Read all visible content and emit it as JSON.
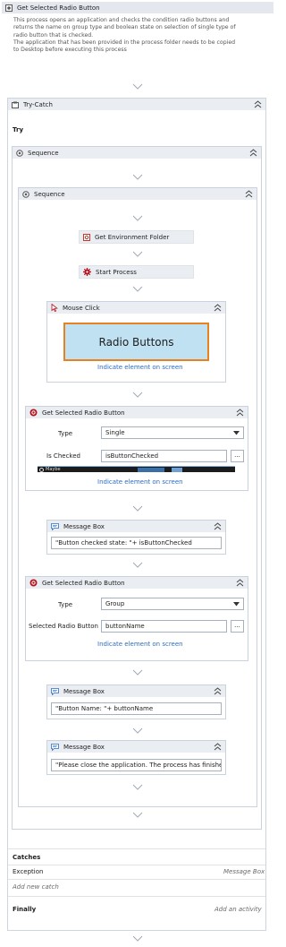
{
  "root": {
    "title": "Get Selected Radio Button",
    "description": [
      "This process opens an application and checks the condition radio buttons and",
      "returns the name on group type and boolean state on selection of single type of",
      "radio button that is checked.",
      "The application that has been provided in the process folder needs to be copied",
      "to Desktop before executing this process"
    ]
  },
  "try_catch": {
    "title": "Try-Catch",
    "try_label": "Try"
  },
  "sequence_outer": {
    "title": "Sequence"
  },
  "sequence_inner": {
    "title": "Sequence"
  },
  "get_env_folder": {
    "title": "Get Environment Folder"
  },
  "start_process": {
    "title": "Start Process"
  },
  "mouse_click": {
    "title": "Mouse Click",
    "target_text": "Radio Buttons",
    "indicate_link": "Indicate element on screen"
  },
  "get_radio_1": {
    "title": "Get Selected Radio Button",
    "type_label": "Type",
    "type_value": "Single",
    "checked_label": "Is Checked",
    "checked_value": "isButtonChecked",
    "dots": "...",
    "strip_text": "Maybe",
    "indicate_link": "Indicate element on screen"
  },
  "msg_box_1": {
    "title": "Message Box",
    "value": "\"Button checked state: \"+ isButtonChecked"
  },
  "get_radio_2": {
    "title": "Get Selected Radio Button",
    "type_label": "Type",
    "type_value": "Group",
    "selected_label": "Selected Radio Button",
    "selected_value": "buttonName",
    "dots": "...",
    "indicate_link": "Indicate element on screen"
  },
  "msg_box_2": {
    "title": "Message Box",
    "value": "\"Button Name: \"+ buttonName"
  },
  "msg_box_3": {
    "title": "Message Box",
    "value": "\"Please close the application. The process has finished i"
  },
  "catches": {
    "title": "Catches",
    "exception_label": "Exception",
    "exception_action": "Message Box",
    "add_new_catch": "Add new catch"
  },
  "finally": {
    "title": "Finally",
    "add_activity": "Add an activity"
  },
  "colors": {
    "accent_orange": "#e8821e",
    "link_blue": "#2b6cc4",
    "header_bg": "#eaeef3",
    "target_bg": "#bfe1f2",
    "error_red": "#b3141f"
  }
}
